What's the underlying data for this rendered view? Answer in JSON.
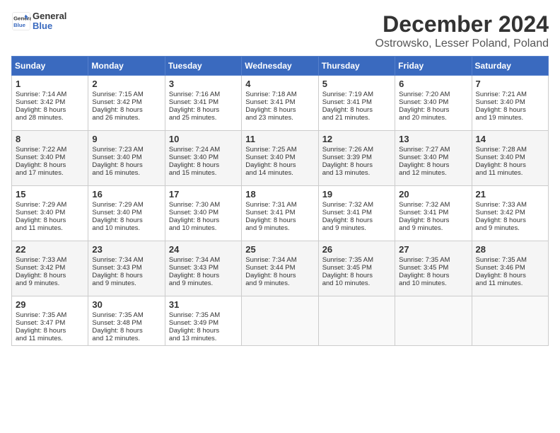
{
  "header": {
    "logo_line1": "General",
    "logo_line2": "Blue",
    "month": "December 2024",
    "location": "Ostrowsko, Lesser Poland, Poland"
  },
  "days_of_week": [
    "Sunday",
    "Monday",
    "Tuesday",
    "Wednesday",
    "Thursday",
    "Friday",
    "Saturday"
  ],
  "weeks": [
    [
      {
        "day": "1",
        "lines": [
          "Sunrise: 7:14 AM",
          "Sunset: 3:42 PM",
          "Daylight: 8 hours",
          "and 28 minutes."
        ]
      },
      {
        "day": "2",
        "lines": [
          "Sunrise: 7:15 AM",
          "Sunset: 3:42 PM",
          "Daylight: 8 hours",
          "and 26 minutes."
        ]
      },
      {
        "day": "3",
        "lines": [
          "Sunrise: 7:16 AM",
          "Sunset: 3:41 PM",
          "Daylight: 8 hours",
          "and 25 minutes."
        ]
      },
      {
        "day": "4",
        "lines": [
          "Sunrise: 7:18 AM",
          "Sunset: 3:41 PM",
          "Daylight: 8 hours",
          "and 23 minutes."
        ]
      },
      {
        "day": "5",
        "lines": [
          "Sunrise: 7:19 AM",
          "Sunset: 3:41 PM",
          "Daylight: 8 hours",
          "and 21 minutes."
        ]
      },
      {
        "day": "6",
        "lines": [
          "Sunrise: 7:20 AM",
          "Sunset: 3:40 PM",
          "Daylight: 8 hours",
          "and 20 minutes."
        ]
      },
      {
        "day": "7",
        "lines": [
          "Sunrise: 7:21 AM",
          "Sunset: 3:40 PM",
          "Daylight: 8 hours",
          "and 19 minutes."
        ]
      }
    ],
    [
      {
        "day": "8",
        "lines": [
          "Sunrise: 7:22 AM",
          "Sunset: 3:40 PM",
          "Daylight: 8 hours",
          "and 17 minutes."
        ]
      },
      {
        "day": "9",
        "lines": [
          "Sunrise: 7:23 AM",
          "Sunset: 3:40 PM",
          "Daylight: 8 hours",
          "and 16 minutes."
        ]
      },
      {
        "day": "10",
        "lines": [
          "Sunrise: 7:24 AM",
          "Sunset: 3:40 PM",
          "Daylight: 8 hours",
          "and 15 minutes."
        ]
      },
      {
        "day": "11",
        "lines": [
          "Sunrise: 7:25 AM",
          "Sunset: 3:40 PM",
          "Daylight: 8 hours",
          "and 14 minutes."
        ]
      },
      {
        "day": "12",
        "lines": [
          "Sunrise: 7:26 AM",
          "Sunset: 3:39 PM",
          "Daylight: 8 hours",
          "and 13 minutes."
        ]
      },
      {
        "day": "13",
        "lines": [
          "Sunrise: 7:27 AM",
          "Sunset: 3:40 PM",
          "Daylight: 8 hours",
          "and 12 minutes."
        ]
      },
      {
        "day": "14",
        "lines": [
          "Sunrise: 7:28 AM",
          "Sunset: 3:40 PM",
          "Daylight: 8 hours",
          "and 11 minutes."
        ]
      }
    ],
    [
      {
        "day": "15",
        "lines": [
          "Sunrise: 7:29 AM",
          "Sunset: 3:40 PM",
          "Daylight: 8 hours",
          "and 11 minutes."
        ]
      },
      {
        "day": "16",
        "lines": [
          "Sunrise: 7:29 AM",
          "Sunset: 3:40 PM",
          "Daylight: 8 hours",
          "and 10 minutes."
        ]
      },
      {
        "day": "17",
        "lines": [
          "Sunrise: 7:30 AM",
          "Sunset: 3:40 PM",
          "Daylight: 8 hours",
          "and 10 minutes."
        ]
      },
      {
        "day": "18",
        "lines": [
          "Sunrise: 7:31 AM",
          "Sunset: 3:41 PM",
          "Daylight: 8 hours",
          "and 9 minutes."
        ]
      },
      {
        "day": "19",
        "lines": [
          "Sunrise: 7:32 AM",
          "Sunset: 3:41 PM",
          "Daylight: 8 hours",
          "and 9 minutes."
        ]
      },
      {
        "day": "20",
        "lines": [
          "Sunrise: 7:32 AM",
          "Sunset: 3:41 PM",
          "Daylight: 8 hours",
          "and 9 minutes."
        ]
      },
      {
        "day": "21",
        "lines": [
          "Sunrise: 7:33 AM",
          "Sunset: 3:42 PM",
          "Daylight: 8 hours",
          "and 9 minutes."
        ]
      }
    ],
    [
      {
        "day": "22",
        "lines": [
          "Sunrise: 7:33 AM",
          "Sunset: 3:42 PM",
          "Daylight: 8 hours",
          "and 9 minutes."
        ]
      },
      {
        "day": "23",
        "lines": [
          "Sunrise: 7:34 AM",
          "Sunset: 3:43 PM",
          "Daylight: 8 hours",
          "and 9 minutes."
        ]
      },
      {
        "day": "24",
        "lines": [
          "Sunrise: 7:34 AM",
          "Sunset: 3:43 PM",
          "Daylight: 8 hours",
          "and 9 minutes."
        ]
      },
      {
        "day": "25",
        "lines": [
          "Sunrise: 7:34 AM",
          "Sunset: 3:44 PM",
          "Daylight: 8 hours",
          "and 9 minutes."
        ]
      },
      {
        "day": "26",
        "lines": [
          "Sunrise: 7:35 AM",
          "Sunset: 3:45 PM",
          "Daylight: 8 hours",
          "and 10 minutes."
        ]
      },
      {
        "day": "27",
        "lines": [
          "Sunrise: 7:35 AM",
          "Sunset: 3:45 PM",
          "Daylight: 8 hours",
          "and 10 minutes."
        ]
      },
      {
        "day": "28",
        "lines": [
          "Sunrise: 7:35 AM",
          "Sunset: 3:46 PM",
          "Daylight: 8 hours",
          "and 11 minutes."
        ]
      }
    ],
    [
      {
        "day": "29",
        "lines": [
          "Sunrise: 7:35 AM",
          "Sunset: 3:47 PM",
          "Daylight: 8 hours",
          "and 11 minutes."
        ]
      },
      {
        "day": "30",
        "lines": [
          "Sunrise: 7:35 AM",
          "Sunset: 3:48 PM",
          "Daylight: 8 hours",
          "and 12 minutes."
        ]
      },
      {
        "day": "31",
        "lines": [
          "Sunrise: 7:35 AM",
          "Sunset: 3:49 PM",
          "Daylight: 8 hours",
          "and 13 minutes."
        ]
      },
      {
        "day": "",
        "lines": []
      },
      {
        "day": "",
        "lines": []
      },
      {
        "day": "",
        "lines": []
      },
      {
        "day": "",
        "lines": []
      }
    ]
  ]
}
